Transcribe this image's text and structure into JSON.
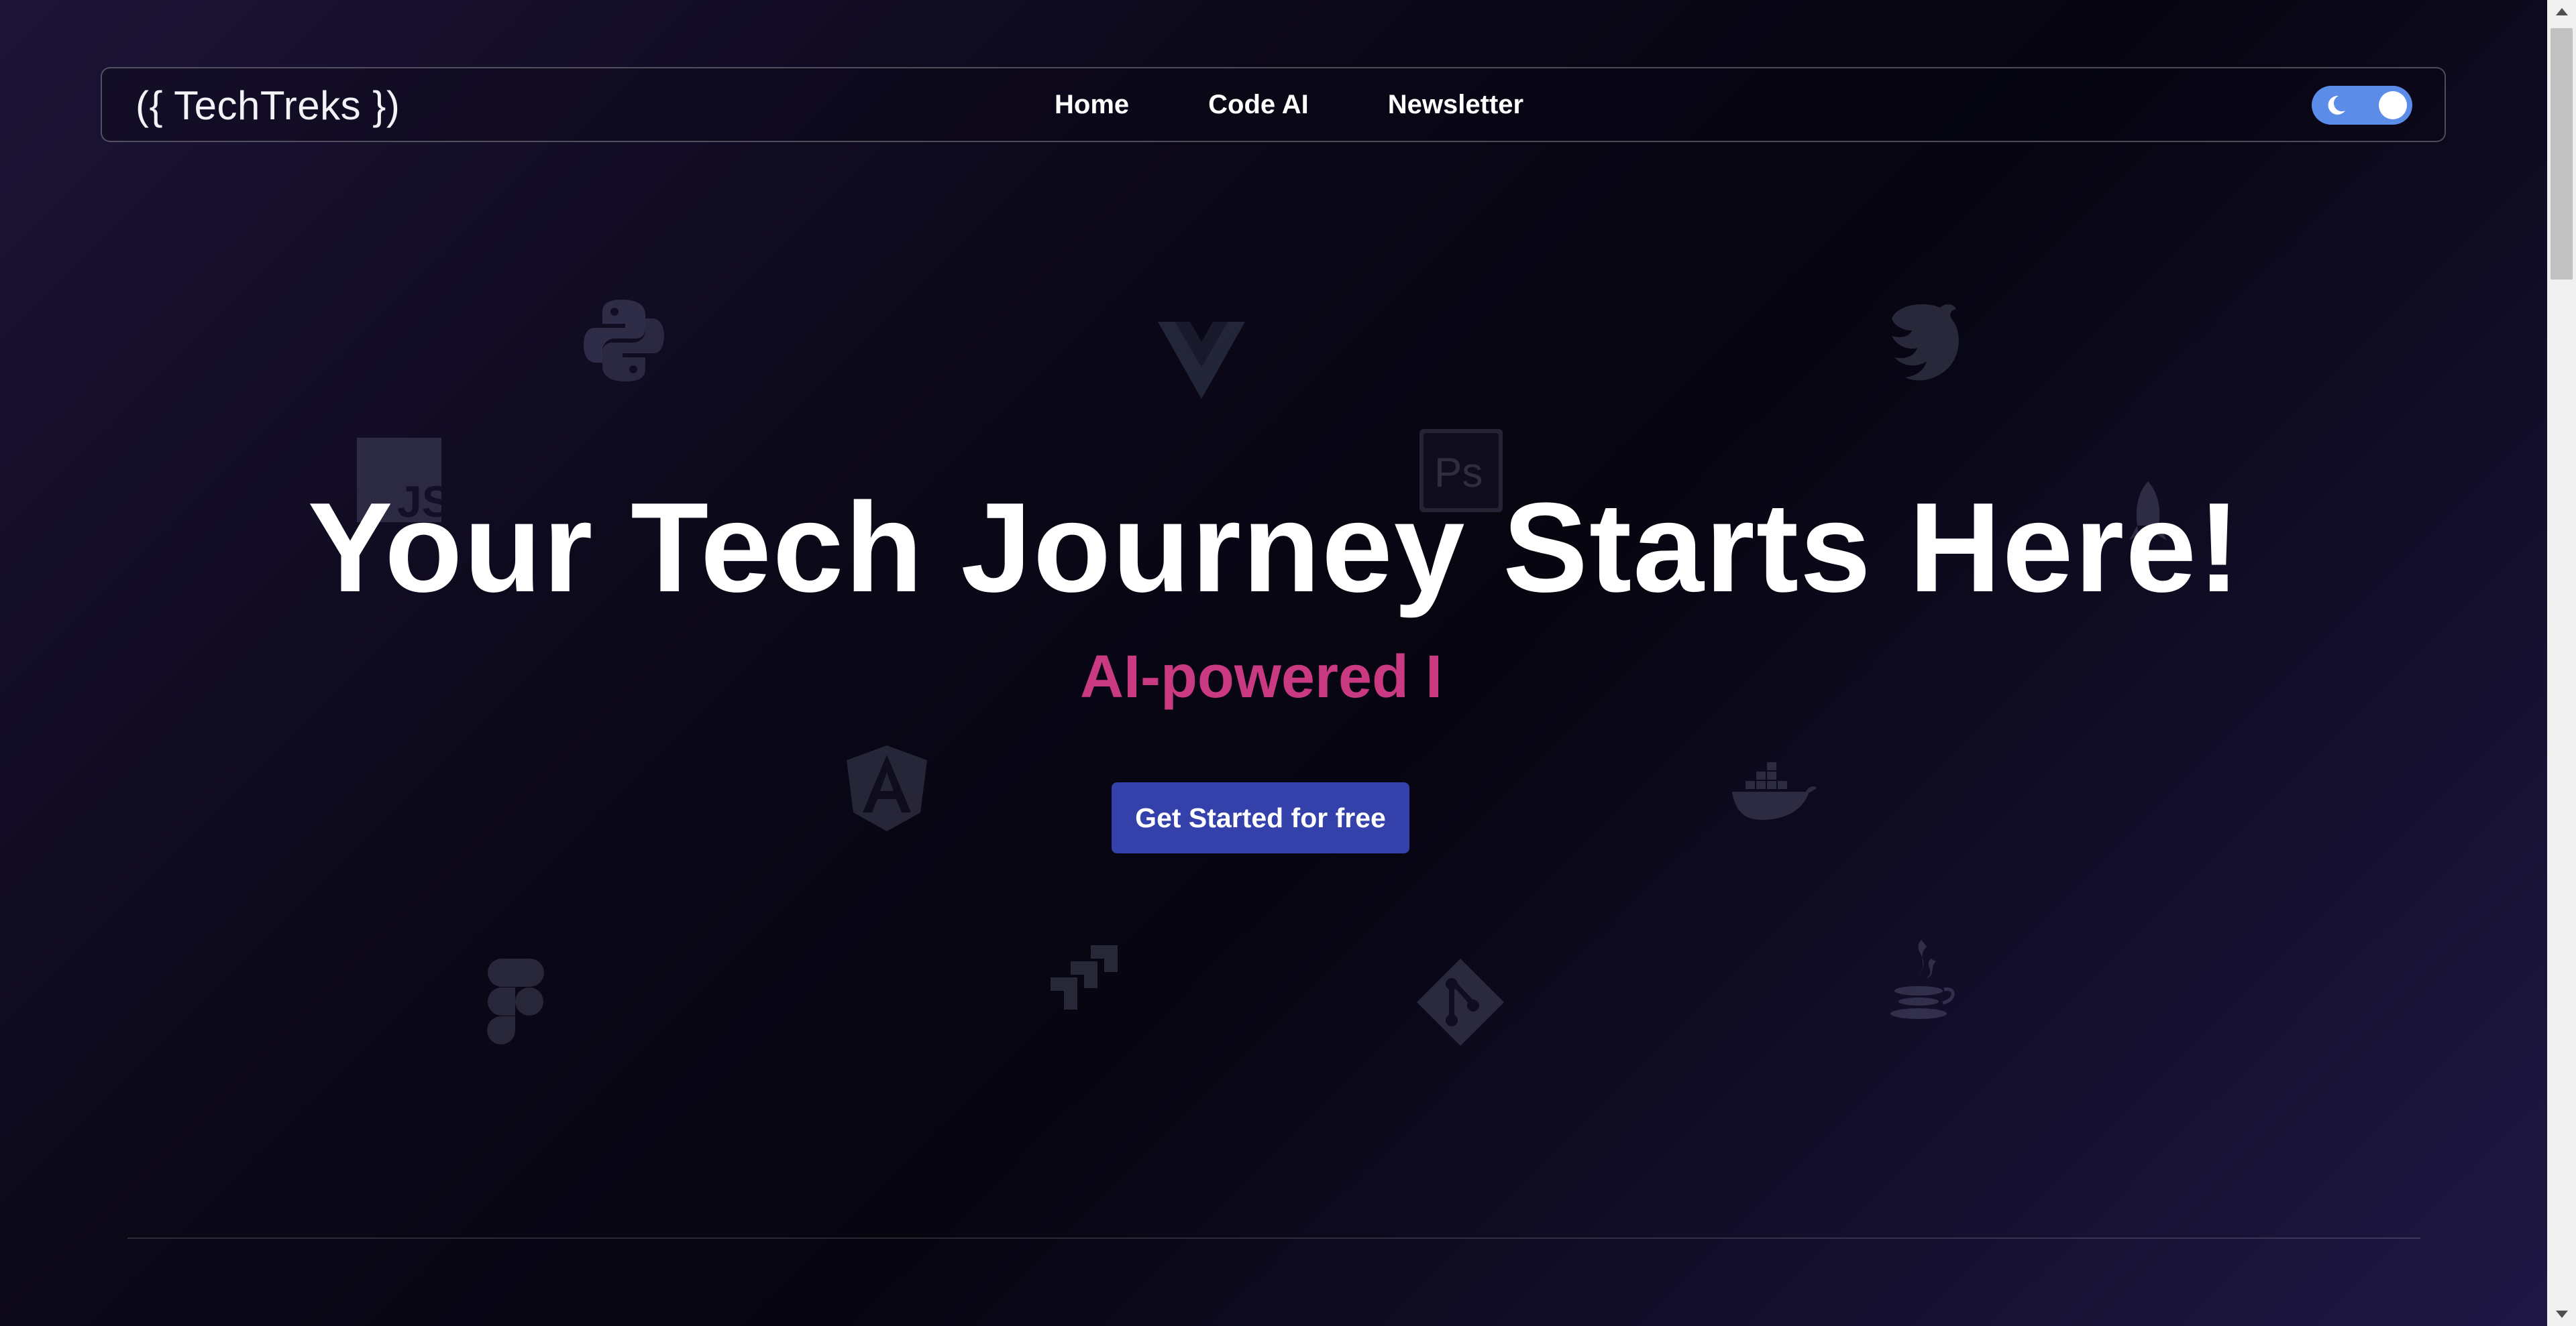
{
  "navbar": {
    "logo": "({ TechTreks })",
    "links": [
      "Home",
      "Code AI",
      "Newsletter"
    ],
    "theme_toggle": {
      "icon": "moon-icon",
      "state": "dark"
    }
  },
  "hero": {
    "title": "Your Tech Journey Starts Here!",
    "subtitle": "AI-powered I",
    "cta_label": "Get Started for free"
  },
  "background_icons": [
    "python-icon",
    "vue-icon",
    "nestjs-icon",
    "javascript-icon",
    "photoshop-icon",
    "rocket-icon",
    "angular-icon",
    "docker-icon",
    "figma-icon",
    "jira-icon",
    "git-icon",
    "java-icon"
  ],
  "colors": {
    "accent": "#c93a82",
    "button": "#3441aa",
    "toggle": "#5b8de8",
    "background_dark": "#0b0818"
  }
}
